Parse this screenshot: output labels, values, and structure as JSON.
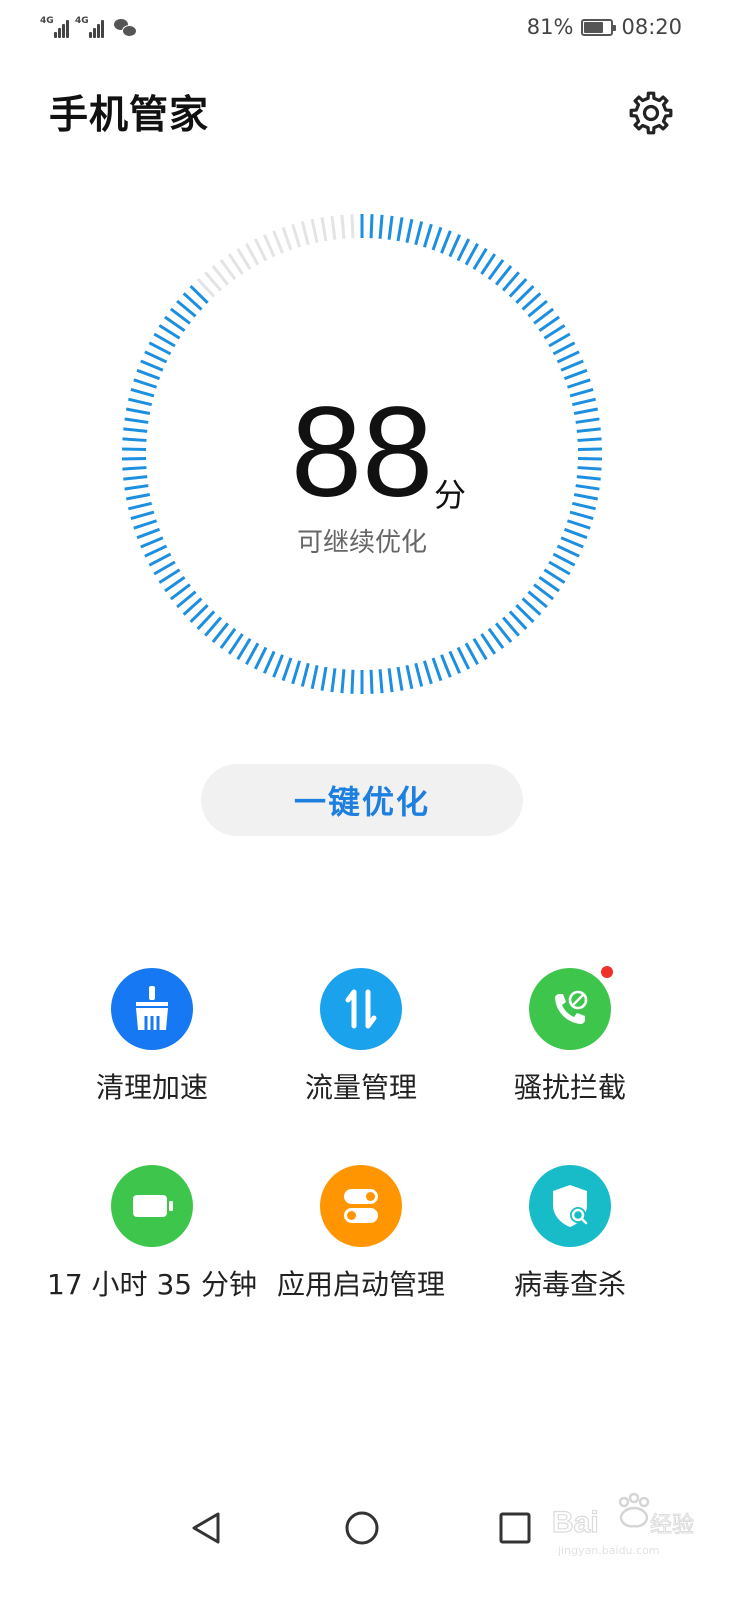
{
  "status_bar": {
    "signal1_tag": "4G",
    "signal2_tag": "4G",
    "battery_percent": "81%",
    "time": "08:20",
    "battery_level": 0.81
  },
  "header": {
    "title": "手机管家",
    "settings_icon": "gear-icon"
  },
  "score": {
    "value": "88",
    "unit": "分",
    "subtitle": "可继续优化",
    "ring_fill": 0.88,
    "accent_color": "#1d8fe0"
  },
  "optimize_button": {
    "label": "一键优化",
    "color": "#1d7fe0"
  },
  "tools": [
    {
      "label": "清理加速",
      "icon": "broom-icon",
      "color": "#1678f2",
      "badge": false
    },
    {
      "label": "流量管理",
      "icon": "data-transfer-icon",
      "color": "#1aa3ec",
      "badge": false
    },
    {
      "label": "骚扰拦截",
      "icon": "phone-block-icon",
      "color": "#3ec64c",
      "badge": true
    },
    {
      "label": "17 小时 35 分钟",
      "icon": "battery-icon",
      "color": "#3ec64c",
      "badge": false
    },
    {
      "label": "应用启动管理",
      "icon": "app-launch-toggle-icon",
      "color": "#ff9500",
      "badge": false
    },
    {
      "label": "病毒查杀",
      "icon": "shield-search-icon",
      "color": "#17bcc8",
      "badge": false
    }
  ],
  "nav": {
    "back_icon": "back-triangle-icon",
    "home_icon": "home-circle-icon",
    "recents_icon": "recents-square-icon"
  },
  "watermark": "Baidu经验 jingyan.baidu.com"
}
